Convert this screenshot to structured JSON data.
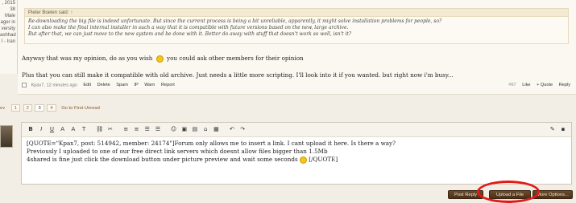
{
  "sidebar": {
    "lines": [
      ", 2015",
      "38",
      "Male",
      "ager in",
      "versity",
      "ashhad",
      "l - Iran"
    ]
  },
  "quote": {
    "author": "Pieter Boelen said:",
    "up_arrow": "↑",
    "lines": [
      "Re-downloading the big file is indeed unfortunate. But since the current process is being a bit unreliable, apparently, it might solve installation problems for people, so?",
      "I can also make the final internal installer in such a way that it is compatible with future versions based on the new, large archive.",
      "But after that, we can just move to the new system and be done with it. Better do away with stuff that doesn't work so well, isn't it?"
    ]
  },
  "post": {
    "line1_a": "Anyway that was my opinion, do as you wish",
    "line1_b": "you could ask other members for their opinion",
    "line2": "Plus that you can still make it compatible with old archive. Just needs a little more scripting. I'll look into it if you wanted. but right now i'm busy...",
    "author": "Kpax7,",
    "time": "12 minutes ago",
    "actions": [
      "Edit",
      "Delete",
      "Spam",
      "IP",
      "Warn",
      "Report"
    ],
    "post_number": "#67",
    "right_actions": [
      "Like",
      "+ Quote",
      "Reply"
    ]
  },
  "pager": {
    "prev": "ev",
    "pages": [
      "1",
      "2",
      "3",
      "4"
    ],
    "current": "3",
    "goto": "Go to First Unread"
  },
  "toolbar": {
    "icons": [
      "B",
      "I",
      "U",
      "A",
      "A",
      "T",
      "⛓",
      "✂",
      "≡",
      "≡",
      "☰",
      "☰",
      "☺",
      "▣",
      "▤",
      "⌂",
      "▦",
      "↶",
      "↷"
    ],
    "right_icons": [
      "✎",
      "▪"
    ]
  },
  "editor": {
    "line1": "[QUOTE=\"Kpax7, post: 514942, member: 24174\"]Forum only allows me to insert a link. I cant upload it here. Is there a way?",
    "line2": "Previously I uploaded to one of our free direct link servers which doesnt allow files bigger than 1.5Mb",
    "line3_a": "4shared is fine just click the download button under picture preview and wait some seconds",
    "line3_b": "[/QUOTE]"
  },
  "buttons": {
    "post_reply": "Post Reply",
    "upload": "Upload a File",
    "more_options": "More Options..."
  },
  "colors": {
    "button_bg": "#5a3b20",
    "highlight_circle": "#e21a1a",
    "background": "#f2eee6"
  }
}
